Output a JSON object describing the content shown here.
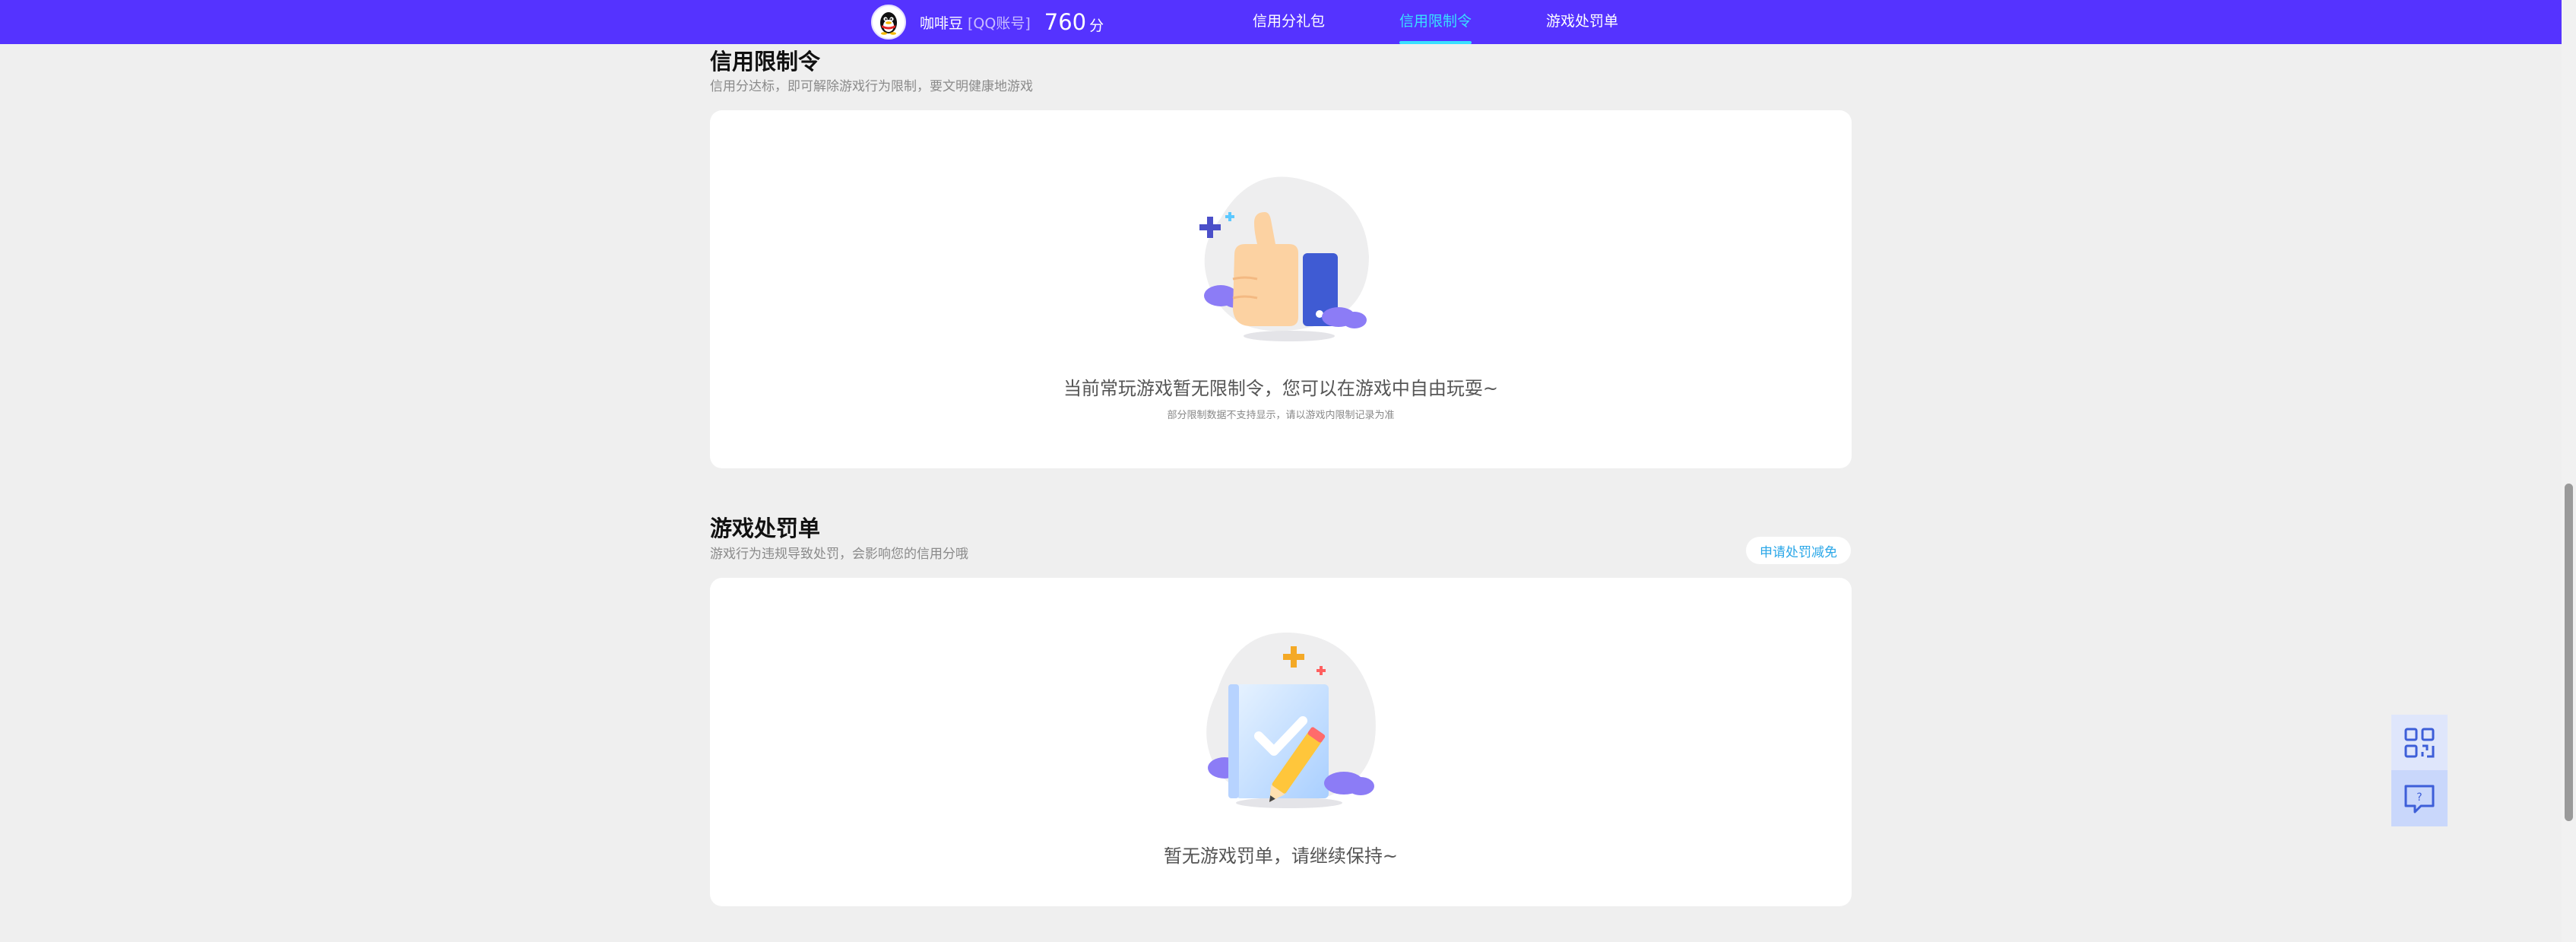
{
  "header": {
    "nickname": "咖啡豆",
    "account_type": "[QQ账号]",
    "score": "760",
    "score_unit": "分",
    "tabs": [
      {
        "label": "信用分礼包",
        "active": false
      },
      {
        "label": "信用限制令",
        "active": true
      },
      {
        "label": "游戏处罚单",
        "active": false
      }
    ],
    "accent_color": "#5533ff",
    "active_tab_color": "#38e0ff"
  },
  "restriction": {
    "title": "信用限制令",
    "subtitle": "信用分达标，即可解除游戏行为限制，要文明健康地游戏",
    "empty_main": "当前常玩游戏暂无限制令，您可以在游戏中自由玩耍~",
    "empty_sub": "部分限制数据不支持显示，请以游戏内限制记录为准",
    "illustration_icon": "thumbs-up-illustration"
  },
  "penalty": {
    "title": "游戏处罚单",
    "subtitle": "游戏行为违规导致处罚，会影响您的信用分哦",
    "appeal_button": "申请处罚减免",
    "empty_main": "暂无游戏罚单，请继续保持~",
    "illustration_icon": "clipboard-check-illustration"
  },
  "floating_tools": {
    "qr_icon": "qr-code-icon",
    "feedback_icon": "feedback-icon"
  }
}
